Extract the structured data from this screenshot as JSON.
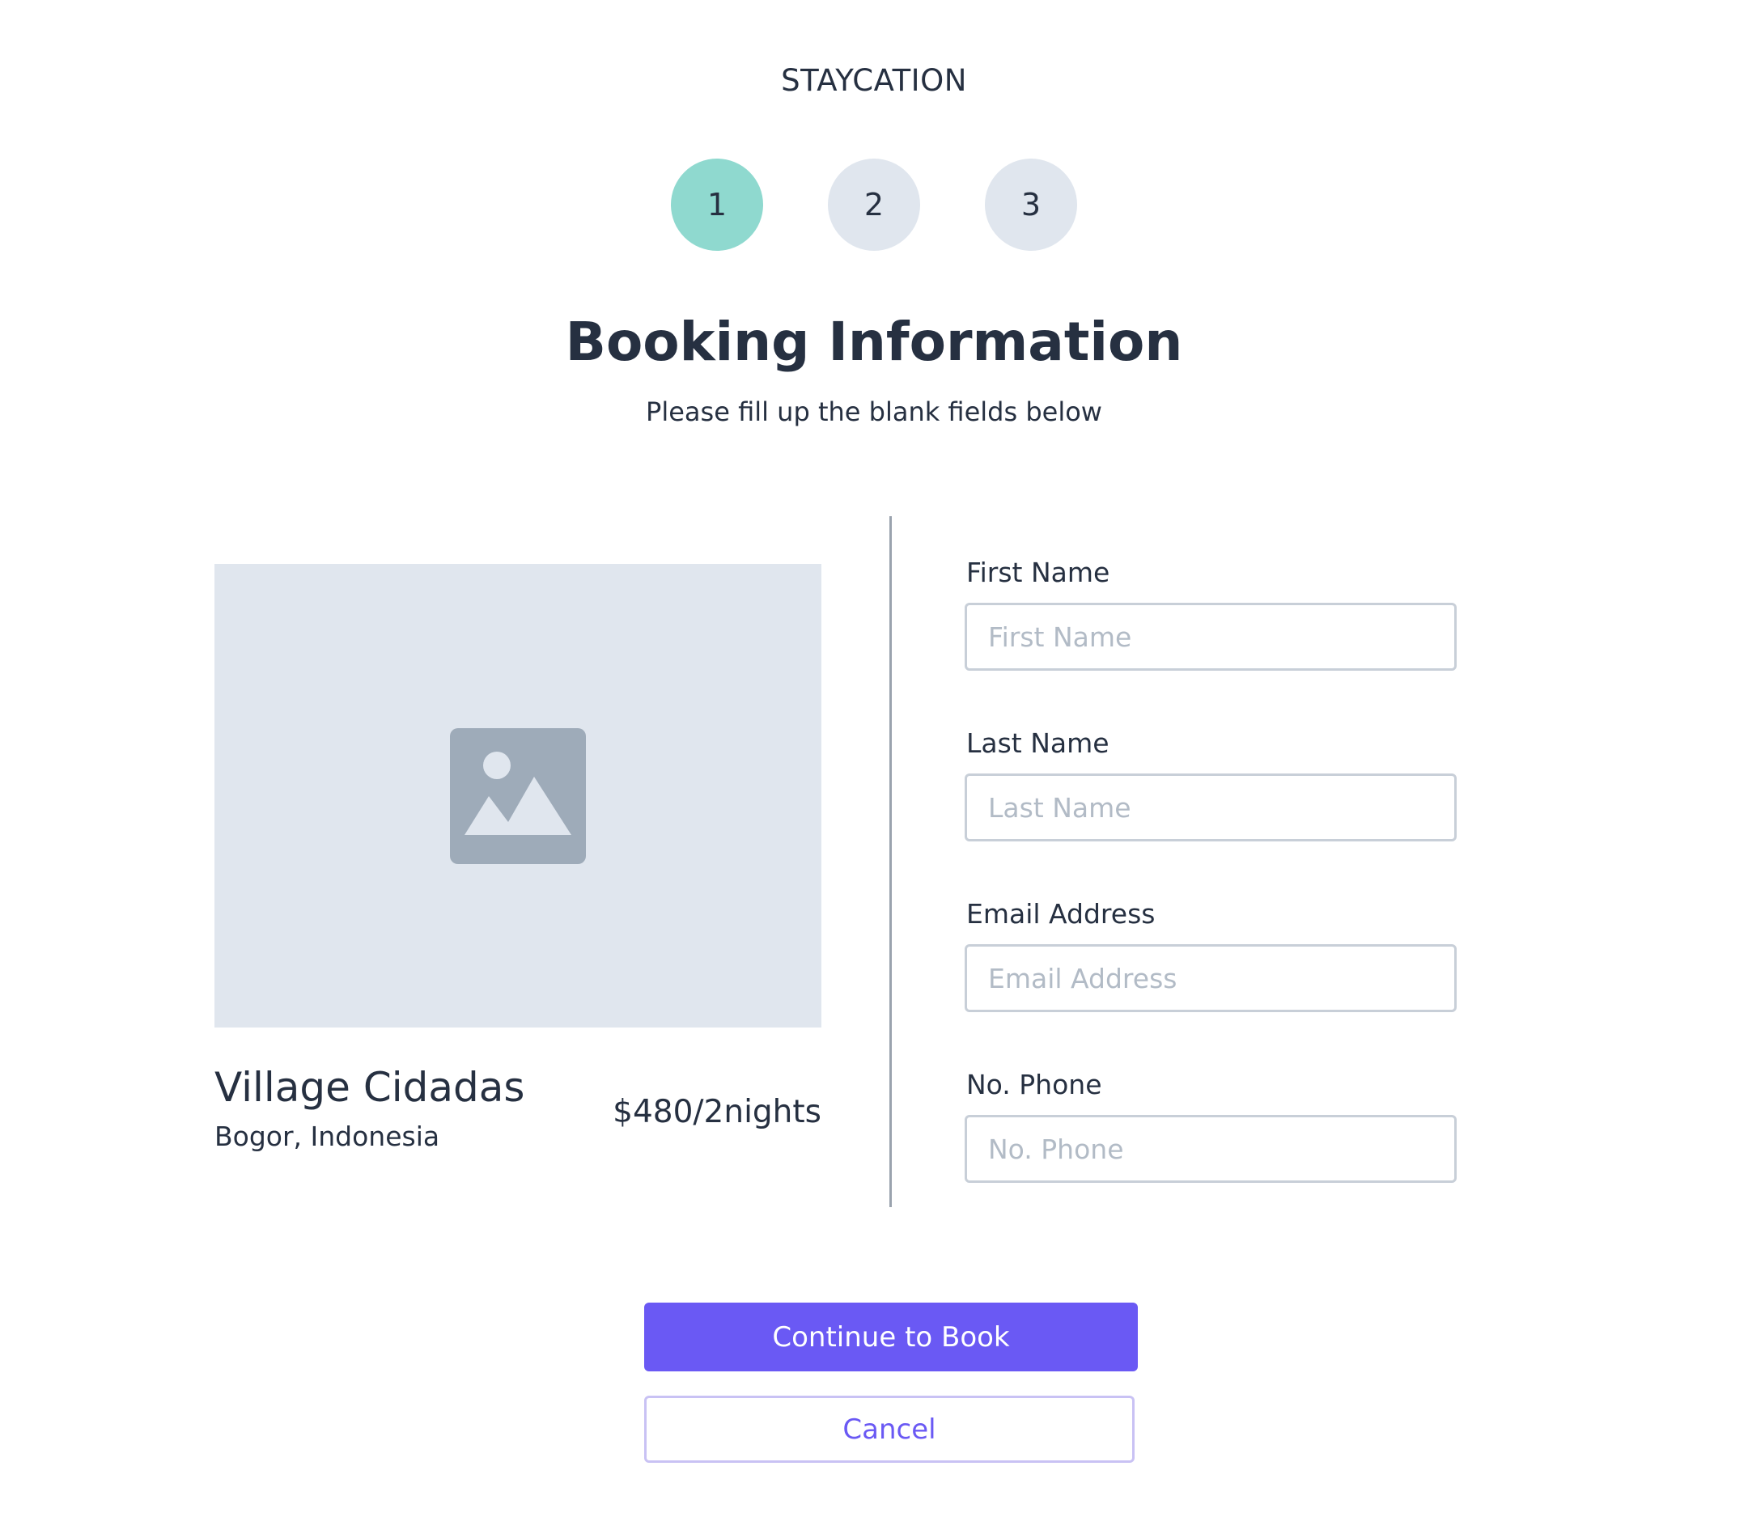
{
  "brand": "STAYCATION",
  "steps": [
    "1",
    "2",
    "3"
  ],
  "active_step": 1,
  "heading": "Booking Information",
  "subheading": "Please fill up the blank fields below",
  "listing": {
    "image_icon": "image-placeholder-icon",
    "name": "Village Cidadas",
    "location": "Bogor, Indonesia",
    "price": "$480/2nights"
  },
  "form": {
    "first_name": {
      "label": "First Name",
      "placeholder": "First Name",
      "value": ""
    },
    "last_name": {
      "label": "Last Name",
      "placeholder": "Last Name",
      "value": ""
    },
    "email": {
      "label": "Email Address",
      "placeholder": "Email Address",
      "value": ""
    },
    "phone": {
      "label": "No. Phone",
      "placeholder": "No. Phone",
      "value": ""
    }
  },
  "actions": {
    "continue_label": "Continue to Book",
    "cancel_label": "Cancel"
  },
  "colors": {
    "accent": "#6a59f4",
    "step_active": "#8fd9cf",
    "step_inactive": "#e0e6ee",
    "text": "#263041"
  }
}
